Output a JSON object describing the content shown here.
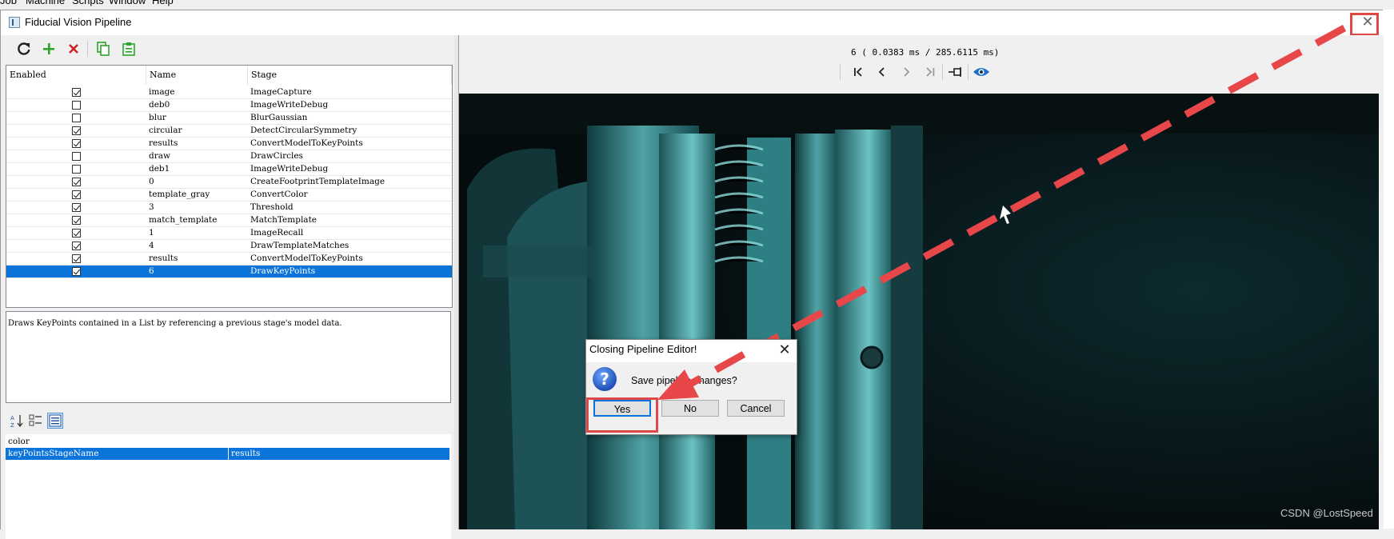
{
  "app_menu": {
    "items": [
      "Job",
      "Machine",
      "Scripts",
      "Window",
      "Help"
    ]
  },
  "window": {
    "title": "Fiducial Vision Pipeline",
    "close_glyph": "✕"
  },
  "toolbar": {
    "buttons": [
      {
        "name": "refresh-icon",
        "color": "#222222"
      },
      {
        "name": "add-icon",
        "color": "#2da42d"
      },
      {
        "name": "delete-icon",
        "color": "#d12121"
      },
      {
        "name": "copy-icon",
        "color": "#2da42d"
      },
      {
        "name": "paste-icon",
        "color": "#2da42d"
      }
    ]
  },
  "stage_table": {
    "columns": [
      "Enabled",
      "Name",
      "Stage"
    ],
    "rows": [
      {
        "enabled": true,
        "name": "image",
        "stage": "ImageCapture"
      },
      {
        "enabled": false,
        "name": "deb0",
        "stage": "ImageWriteDebug"
      },
      {
        "enabled": false,
        "name": "blur",
        "stage": "BlurGaussian"
      },
      {
        "enabled": true,
        "name": "circular",
        "stage": "DetectCircularSymmetry"
      },
      {
        "enabled": true,
        "name": "results",
        "stage": "ConvertModelToKeyPoints"
      },
      {
        "enabled": false,
        "name": "draw",
        "stage": "DrawCircles"
      },
      {
        "enabled": false,
        "name": "deb1",
        "stage": "ImageWriteDebug"
      },
      {
        "enabled": true,
        "name": "0",
        "stage": "CreateFootprintTemplateImage"
      },
      {
        "enabled": true,
        "name": "template_gray",
        "stage": "ConvertColor"
      },
      {
        "enabled": true,
        "name": "3",
        "stage": "Threshold"
      },
      {
        "enabled": true,
        "name": "match_template",
        "stage": "MatchTemplate"
      },
      {
        "enabled": true,
        "name": "1",
        "stage": "ImageRecall"
      },
      {
        "enabled": true,
        "name": "4",
        "stage": "DrawTemplateMatches"
      },
      {
        "enabled": true,
        "name": "results",
        "stage": "ConvertModelToKeyPoints"
      },
      {
        "enabled": true,
        "name": "6",
        "stage": "DrawKeyPoints",
        "selected": true
      }
    ]
  },
  "description": "Draws KeyPoints contained in a List by referencing a previous stage's model data.",
  "property_grid": {
    "rows": [
      {
        "key": "color",
        "value": ""
      },
      {
        "key": "keyPointsStageName",
        "value": "results",
        "selected": true
      }
    ]
  },
  "viewer": {
    "status": "6 ( 0.0383 ms / 285.6115 ms)",
    "nav": [
      "first-icon",
      "prev-icon",
      "next-icon",
      "last-icon",
      "pin-icon",
      "eye-icon"
    ]
  },
  "dialog": {
    "title": "Closing Pipeline Editor!",
    "message": "Save pipeline changes?",
    "icon_glyph": "?",
    "close_glyph": "✕",
    "buttons": {
      "yes": "Yes",
      "no": "No",
      "cancel": "Cancel"
    }
  },
  "watermark": "CSDN @LostSpeed",
  "colors": {
    "selection": "#0a74da",
    "annotation": "#e04848"
  }
}
